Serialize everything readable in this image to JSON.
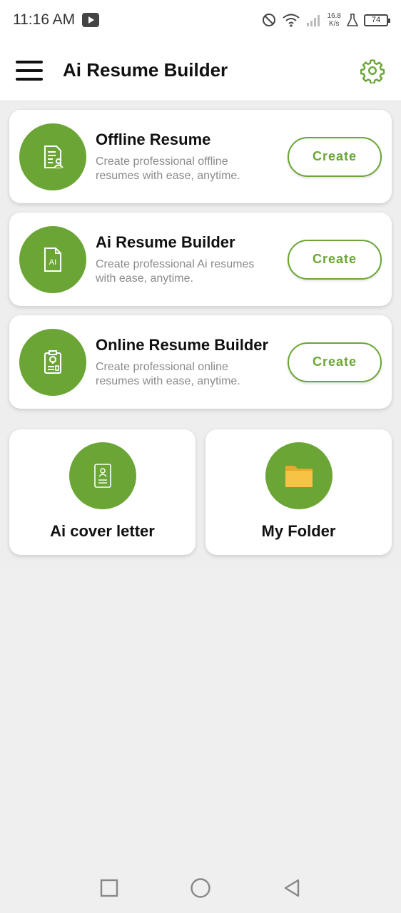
{
  "status": {
    "time": "11:16 AM",
    "speed_value": "16.8",
    "speed_unit": "K/s",
    "battery": "74"
  },
  "appbar": {
    "title": "Ai Resume Builder",
    "menu_icon": "hamburger-menu-icon",
    "settings_icon": "gear-icon"
  },
  "cards": [
    {
      "title": "Offline Resume",
      "description": "Create professional offline resumes with ease, anytime.",
      "button": "Create",
      "icon": "offline-resume-icon"
    },
    {
      "title": "Ai Resume Builder",
      "description": "Create professional Ai resumes with ease, anytime.",
      "button": "Create",
      "icon": "ai-document-icon",
      "icon_text": "AI"
    },
    {
      "title": "Online Resume Builder",
      "description": "Create professional online resumes with ease, anytime.",
      "button": "Create",
      "icon": "online-resume-icon"
    }
  ],
  "tiles": [
    {
      "label": "Ai cover letter",
      "icon": "cover-letter-icon"
    },
    {
      "label": "My Folder",
      "icon": "folder-icon"
    }
  ],
  "colors": {
    "accent": "#6aa535",
    "folder": "#f6c344",
    "background": "#eeeeee"
  }
}
